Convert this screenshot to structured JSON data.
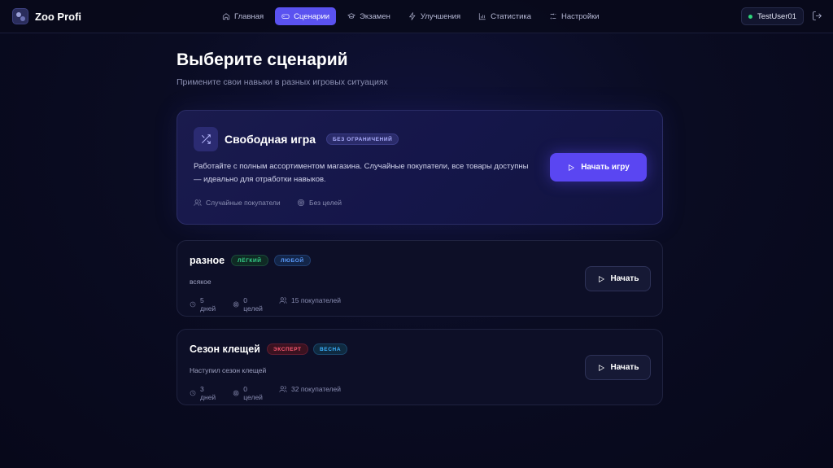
{
  "app": {
    "name": "Zoo Profi"
  },
  "nav": {
    "items": [
      {
        "label": "Главная",
        "icon": "home-icon"
      },
      {
        "label": "Сценарии",
        "icon": "gamepad-icon",
        "active": true
      },
      {
        "label": "Экзамен",
        "icon": "graduation-cap-icon"
      },
      {
        "label": "Улучшения",
        "icon": "lightning-icon"
      },
      {
        "label": "Статистика",
        "icon": "bar-chart-icon"
      },
      {
        "label": "Настройки",
        "icon": "sliders-icon"
      }
    ]
  },
  "user": {
    "name": "TestUser01",
    "status_color": "#2ed47a"
  },
  "page": {
    "title": "Выберите сценарий",
    "subtitle": "Примените свои навыки в разных игровых ситуациях"
  },
  "free_game": {
    "title": "Свободная игра",
    "badge": "БЕЗ ОГРАНИЧЕНИЙ",
    "description": "Работайте с полным ассортиментом магазина. Случайные покупатели, все товары доступны — идеально для отработки навыков.",
    "meta": [
      "Случайные покупатели",
      "Без целей"
    ],
    "button": "Начать игру"
  },
  "scenarios": [
    {
      "title": "разное",
      "badges": [
        "ЛЁГКИЙ",
        "ЛЮБОЙ"
      ],
      "description": "всякое",
      "days": "5 дней",
      "goals": "0 целей",
      "customers": "15 покупателей",
      "button": "Начать"
    },
    {
      "title": "Сезон клещей",
      "badges": [
        "ЭКСПЕРТ",
        "ВЕСНА"
      ],
      "description": "Наступил сезон клещей",
      "days": "3 дней",
      "goals": "0 целей",
      "customers": "32 покупателей",
      "button": "Начать"
    }
  ],
  "colors": {
    "accent": "#5a46f2",
    "background": "#0a0c22"
  }
}
